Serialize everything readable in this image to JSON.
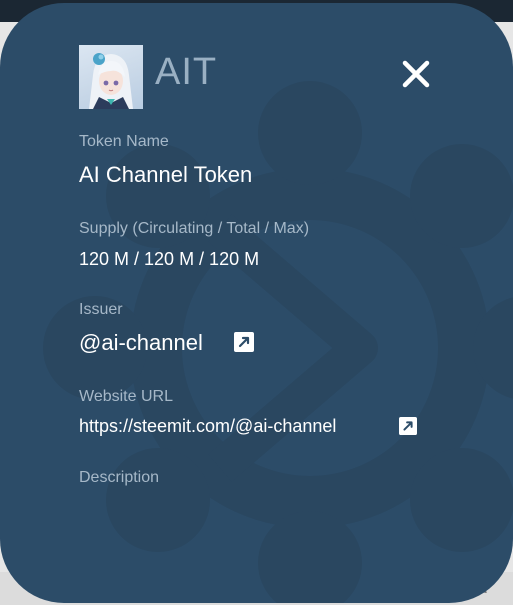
{
  "token": {
    "symbol": "AIT",
    "avatar_icon": "anime-girl-avatar",
    "close_icon": "close-x-icon"
  },
  "fields": {
    "name_label": "Token Name",
    "name_value": "AI Channel Token",
    "supply_label": "Supply (Circulating / Total / Max)",
    "supply_value": "120 M / 120 M / 120 M",
    "issuer_label": "Issuer",
    "issuer_value": "@ai-channel",
    "website_label": "Website URL",
    "website_value": "https://steemit.com/@ai-channel",
    "description_label": "Description"
  },
  "page": {
    "corner_glyph": "–"
  },
  "colors": {
    "card": "#2c4c68",
    "label": "#a6b8c8",
    "value": "#ffffff",
    "symbol": "#9ab0c3"
  }
}
